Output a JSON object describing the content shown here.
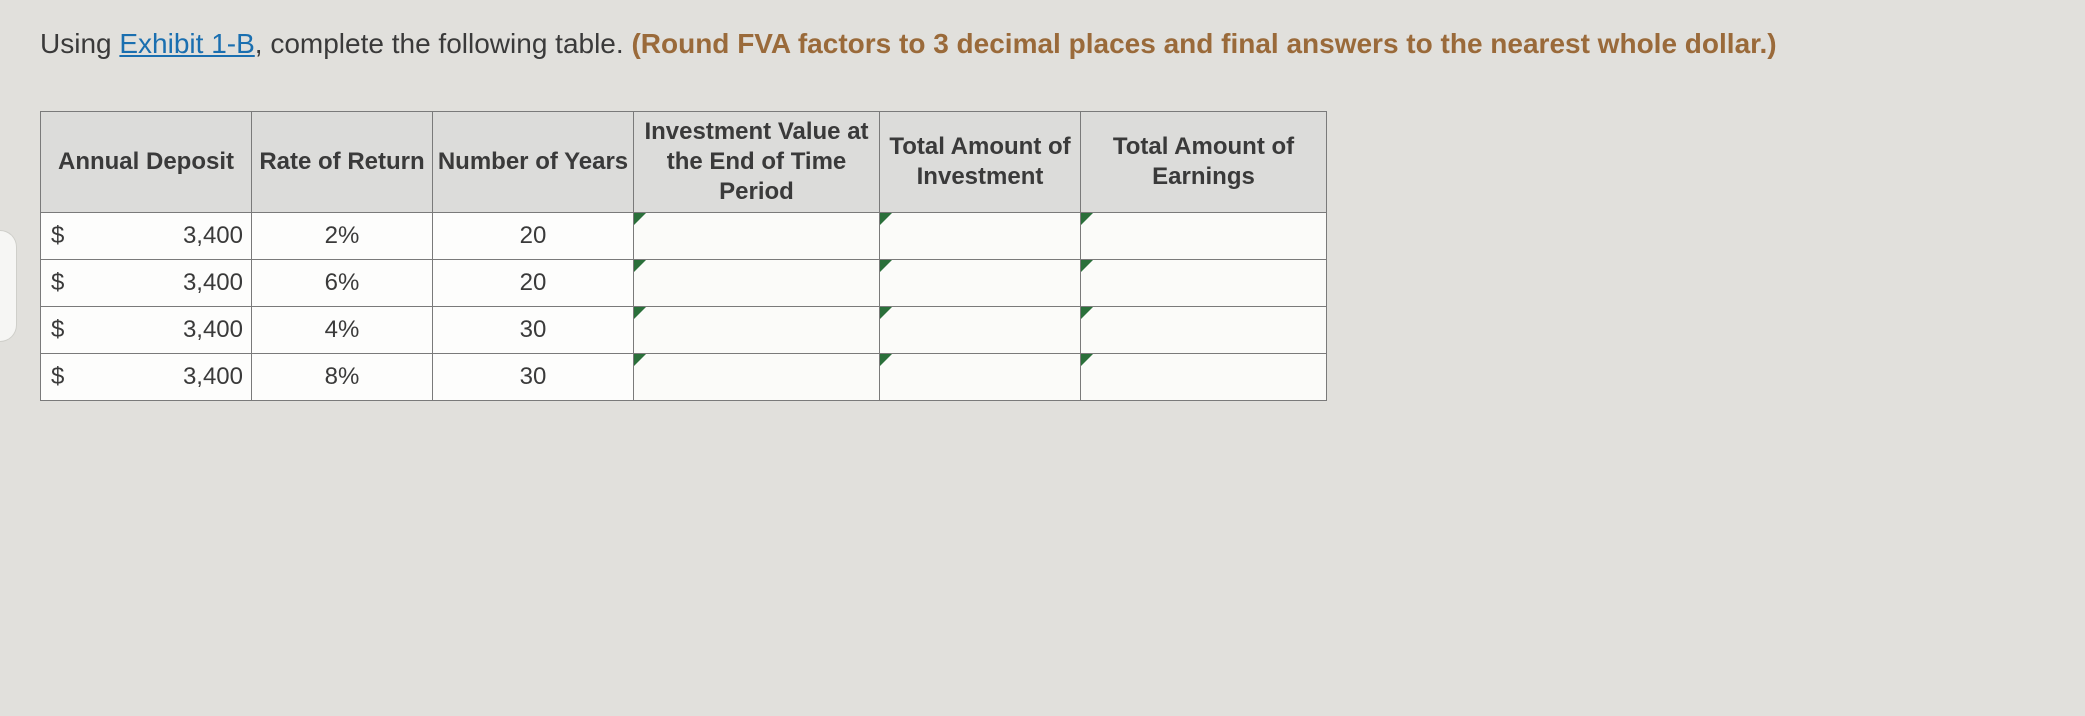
{
  "prompt": {
    "lead": "Using ",
    "link": "Exhibit 1-B",
    "mid": ", complete the following table. ",
    "bold": "(Round FVA factors to 3 decimal places and final answers to the nearest whole dollar.)"
  },
  "headers": {
    "deposit": "Annual Deposit",
    "rate": "Rate of Return",
    "years": "Number of Years",
    "value": "Investment Value at the End of Time Period",
    "total": "Total Amount of Investment",
    "earnings": "Total Amount of Earnings"
  },
  "currency": "$",
  "rows": [
    {
      "deposit": "3,400",
      "rate": "2%",
      "years": "20",
      "value": "",
      "total": "",
      "earnings": ""
    },
    {
      "deposit": "3,400",
      "rate": "6%",
      "years": "20",
      "value": "",
      "total": "",
      "earnings": ""
    },
    {
      "deposit": "3,400",
      "rate": "4%",
      "years": "30",
      "value": "",
      "total": "",
      "earnings": ""
    },
    {
      "deposit": "3,400",
      "rate": "8%",
      "years": "30",
      "value": "",
      "total": "",
      "earnings": ""
    }
  ]
}
